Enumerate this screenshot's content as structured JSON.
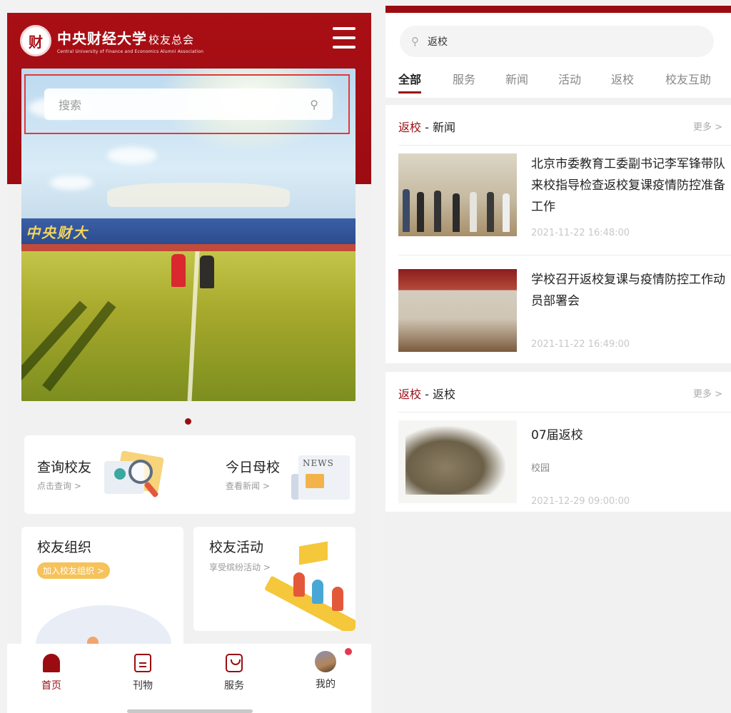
{
  "left": {
    "logo": {
      "seal_char": "财",
      "name_cn": "中央财经大学",
      "name_suffix": "校友总会",
      "name_en": "Central University of Finance and Economics Alumni Association"
    },
    "menu_icon": "hamburger-menu-icon",
    "search": {
      "placeholder": "搜索",
      "icon": "search-icon"
    },
    "hero": {
      "stand_text": "中央财大"
    },
    "quick_cards": [
      {
        "title": "查询校友",
        "sub": "点击查询 >"
      },
      {
        "title": "今日母校",
        "sub": "查看新闻 >",
        "art_label": "NEWS"
      }
    ],
    "org_card": {
      "title": "校友组织",
      "button": "加入校友组织 >"
    },
    "activity_card": {
      "title": "校友活动",
      "sub": "享受缤纷活动 >"
    },
    "tabbar": [
      {
        "label": "首页",
        "icon": "home-icon",
        "active": true
      },
      {
        "label": "刊物",
        "icon": "journal-icon",
        "active": false
      },
      {
        "label": "服务",
        "icon": "shopping-bag-icon",
        "active": false
      },
      {
        "label": "我的",
        "icon": "avatar-icon",
        "active": false,
        "badge_dot": true
      }
    ],
    "colors": {
      "brand": "#9b0c12",
      "highlight_border": "#e53935",
      "pill": "#f6c25a"
    }
  },
  "right": {
    "search": {
      "value": "返校",
      "icon": "search-icon"
    },
    "tabs": [
      "全部",
      "服务",
      "新闻",
      "活动",
      "返校",
      "校友互助"
    ],
    "active_tab": "全部",
    "sections": [
      {
        "keyword": "返校",
        "category": " - 新闻",
        "more": "更多 >",
        "items": [
          {
            "title": "北京市委教育工委副书记李军锋带队来校指导检查返校复课疫情防控准备工作",
            "date": "2021-11-22 16:48:00"
          },
          {
            "title": "学校召开返校复课与疫情防控工作动员部署会",
            "date": "2021-11-22 16:49:00"
          }
        ]
      },
      {
        "keyword": "返校",
        "category": " - 返校",
        "more": "更多 >",
        "items": [
          {
            "title": "07届返校",
            "sub": "校园",
            "date": "2021-12-29 09:00:00"
          }
        ]
      }
    ]
  }
}
